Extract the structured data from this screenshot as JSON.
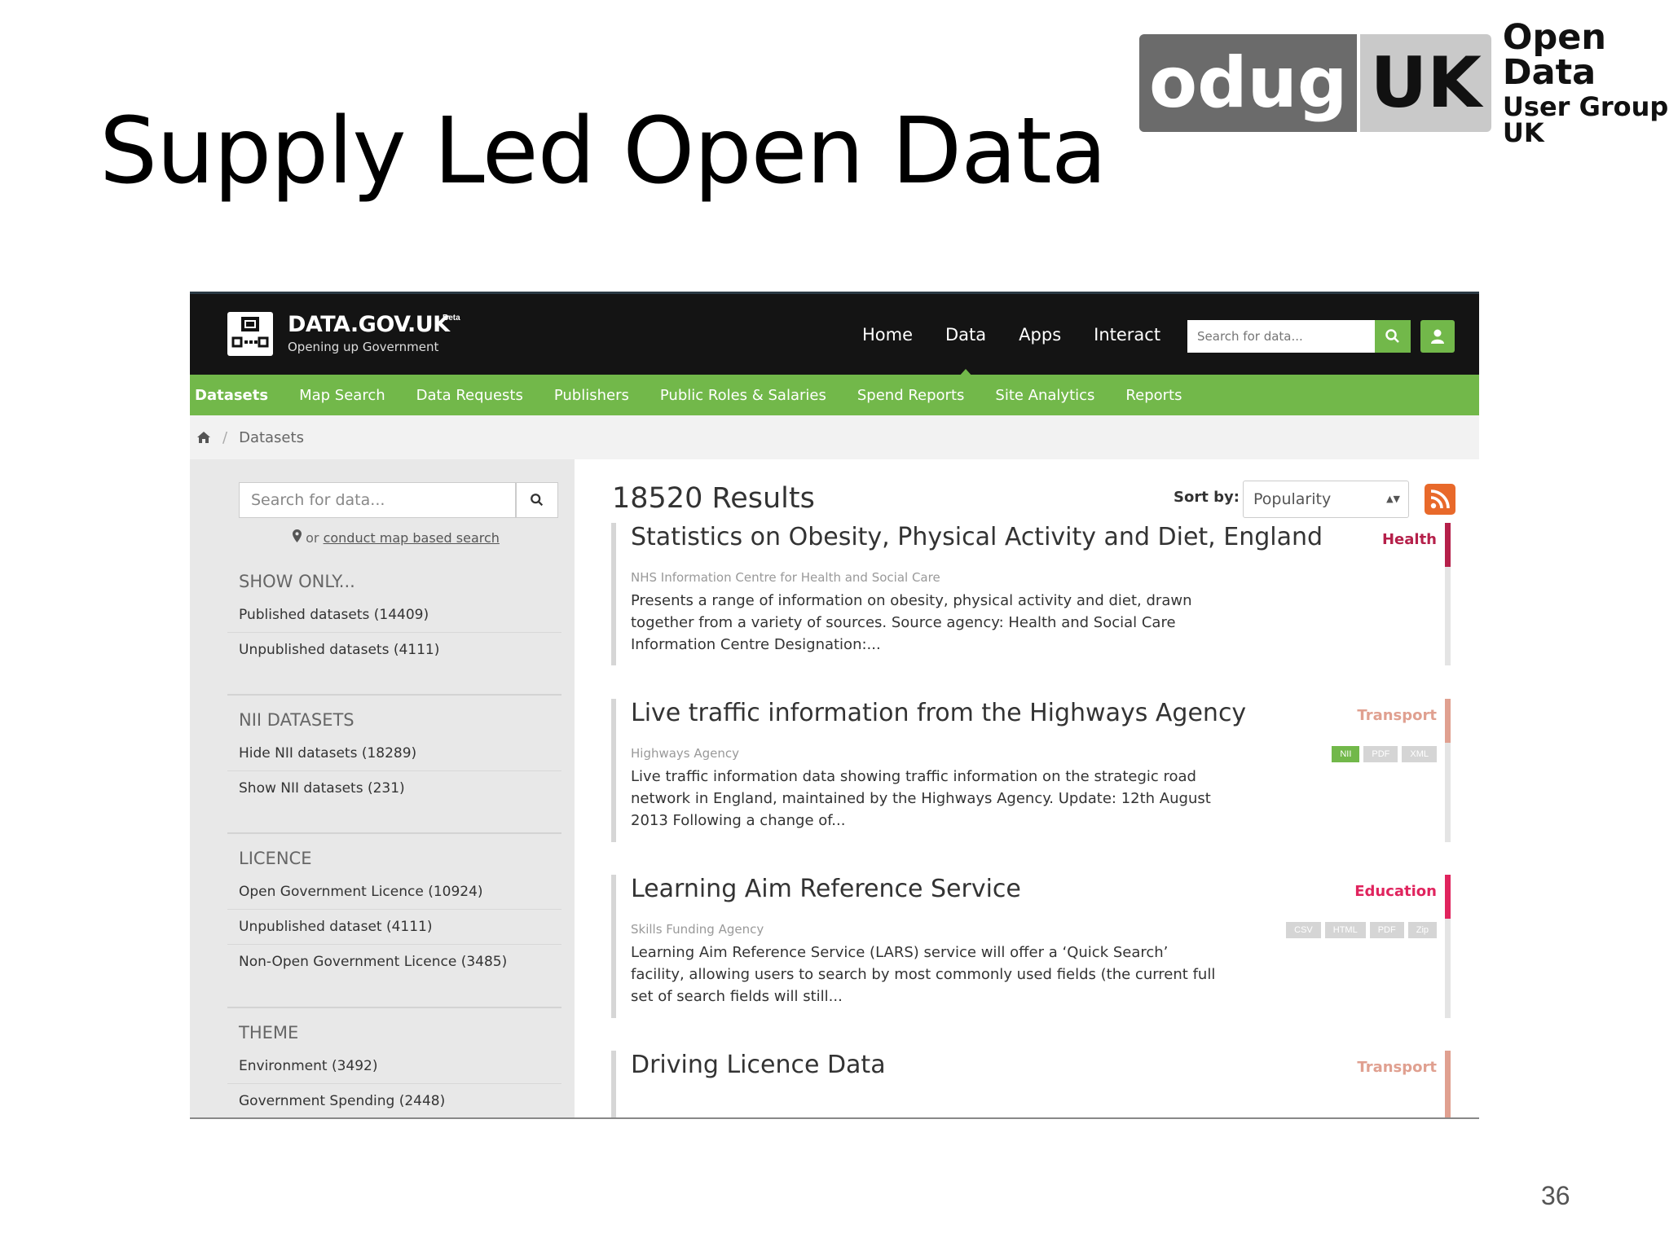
{
  "slide": {
    "title": "Supply Led Open Data",
    "logo": {
      "mark_left": "odug",
      "mark_right": "UK",
      "tagline_line1": "Open Data",
      "tagline_line2": "User Group UK"
    },
    "page_number": "36"
  },
  "site": {
    "name": "DATA.GOV.UK",
    "beta": "Beta",
    "tagline": "Opening up Government",
    "nav": [
      "Home",
      "Data",
      "Apps",
      "Interact"
    ],
    "active_nav": "Data",
    "search_placeholder": "Search for data..."
  },
  "subnav": [
    "Datasets",
    "Map Search",
    "Data Requests",
    "Publishers",
    "Public Roles & Salaries",
    "Spend Reports",
    "Site Analytics",
    "Reports"
  ],
  "breadcrumb": {
    "current": "Datasets"
  },
  "sidebar": {
    "search_placeholder": "Search for data...",
    "map_prefix": "or",
    "map_link": "conduct map based search",
    "facets": [
      {
        "title": "SHOW ONLY...",
        "items": [
          "Published datasets (14409)",
          "Unpublished datasets (4111)"
        ]
      },
      {
        "title": "NII DATASETS",
        "items": [
          "Hide NII datasets (18289)",
          "Show NII datasets (231)"
        ]
      },
      {
        "title": "LICENCE",
        "items": [
          "Open Government Licence (10924)",
          "Unpublished dataset (4111)",
          "Non-Open Government Licence (3485)"
        ]
      },
      {
        "title": "THEME",
        "items": [
          "Environment (3492)",
          "Government Spending (2448)"
        ]
      }
    ]
  },
  "results": {
    "count": "18520 Results",
    "sort_label": "Sort by:",
    "sort_value": "Popularity",
    "items": [
      {
        "title": "Statistics on Obesity, Physical Activity and Diet, England",
        "publisher": "NHS Information Centre for Health and Social Care",
        "description": "Presents a range of information on obesity, physical activity and diet, drawn together from a variety of sources. Source agency: Health and Social Care Information Centre Designation:...",
        "theme": "Health",
        "theme_color": "#b5204a",
        "formats": []
      },
      {
        "title": "Live traffic information from the Highways Agency",
        "publisher": "Highways Agency",
        "description": "Live traffic information data showing traffic information on the strategic road network in England, maintained by the Highways Agency. Update: 12th August 2013 Following a change of...",
        "theme": "Transport",
        "theme_color": "#e0a090",
        "formats": [
          "NII",
          "PDF",
          "XML"
        ]
      },
      {
        "title": "Learning Aim Reference Service",
        "publisher": "Skills Funding Agency",
        "description": "Learning Aim Reference Service (LARS) service will offer a ‘Quick Search’ facility, allowing users to search by most commonly used fields (the current full set of search fields will still...",
        "theme": "Education",
        "theme_color": "#e0245e",
        "formats": [
          "CSV",
          "HTML",
          "PDF",
          "Zip"
        ]
      },
      {
        "title": "Driving Licence Data",
        "publisher": "",
        "description": "",
        "theme": "Transport",
        "theme_color": "#e0a090",
        "formats": []
      }
    ]
  }
}
